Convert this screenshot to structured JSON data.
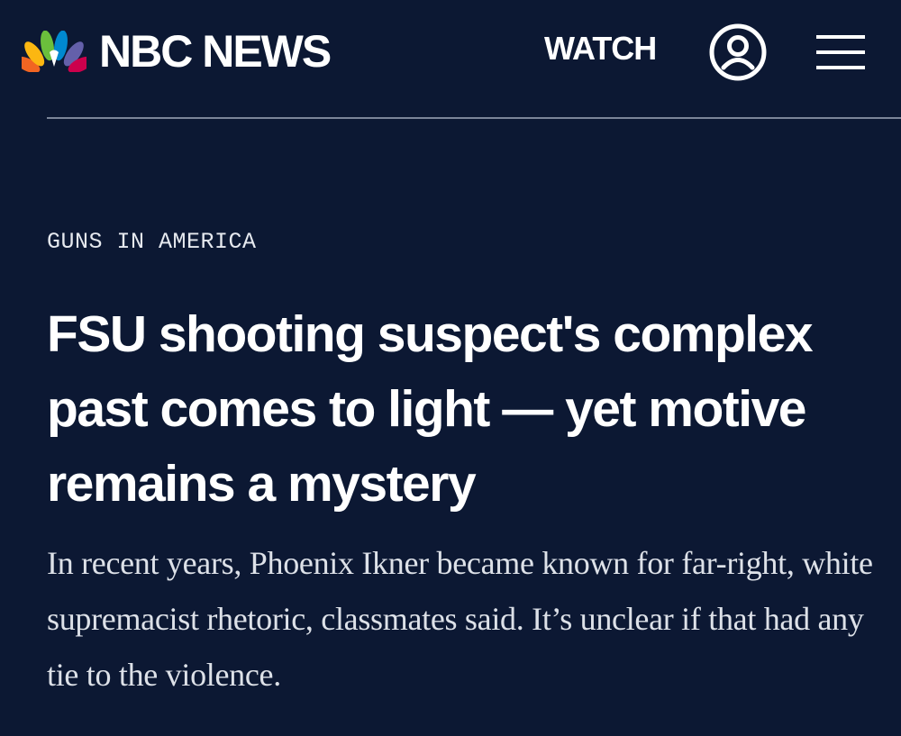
{
  "header": {
    "logo_text": "NBC NEWS",
    "watch_label": "WATCH",
    "account_icon": "account-icon",
    "menu_icon": "menu-icon"
  },
  "article": {
    "category": "GUNS IN AMERICA",
    "headline": "FSU shooting suspect's complex past comes to light — yet motive remains a mystery",
    "dek": "In recent years, Phoenix Ikner became known for far-right, white supremacist rhetoric, classmates said. It’s unclear if that had any tie to the violence."
  },
  "colors": {
    "background": "#0c1833",
    "text": "#ffffff",
    "divider": "#7b8599",
    "peacock": [
      "#f26522",
      "#fcb711",
      "#6bbf3c",
      "#0089d0",
      "#6460aa",
      "#cc004c"
    ]
  }
}
